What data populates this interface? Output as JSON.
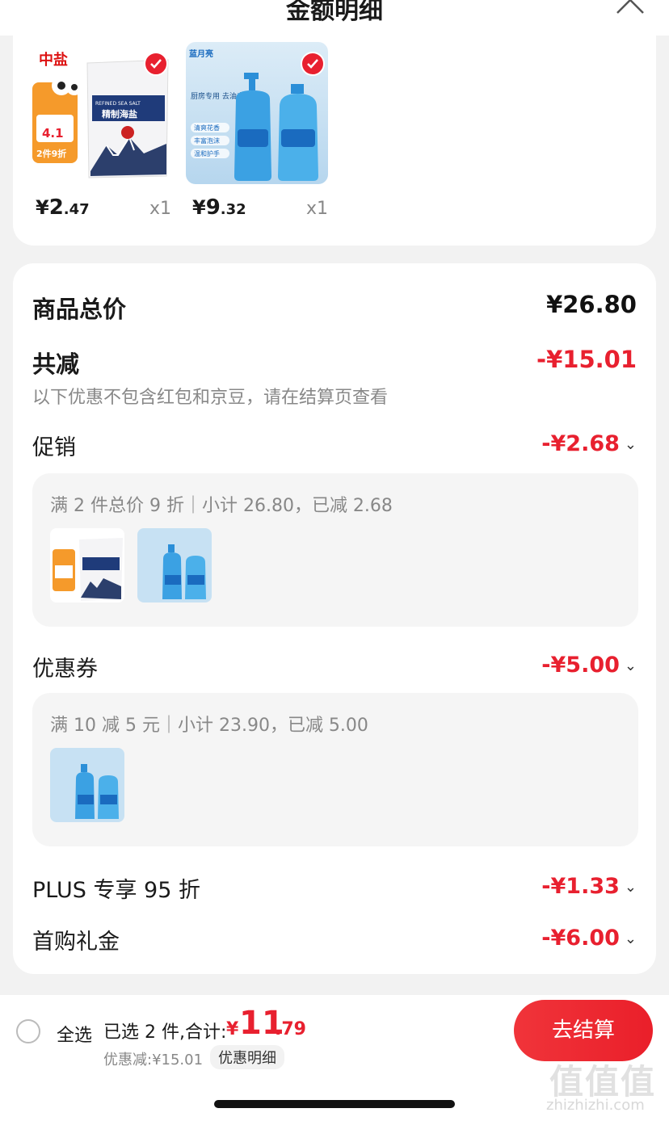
{
  "header": {
    "title": "金额明细"
  },
  "products": [
    {
      "name": "salt",
      "price_int": "2",
      "price_dec": ".47",
      "currency": "¥",
      "qty": "x1",
      "selected": true
    },
    {
      "name": "handwash",
      "price_int": "9",
      "price_dec": ".32",
      "currency": "¥",
      "qty": "x1",
      "selected": true
    }
  ],
  "product_image_text": {
    "salt_brand": "中盐",
    "salt_pkg_en": "REFINED SEA SALT",
    "salt_pkg_cn": "精制海盐",
    "salt_promo_price": "4.1",
    "salt_promo_deal": "2件9折",
    "wash_brand": "蓝月亮",
    "wash_caption": "厨房专用 去油去油腻",
    "wash_tags": [
      "清爽花香",
      "丰富泡沫",
      "温和护手"
    ]
  },
  "summary": {
    "total_label": "商品总价",
    "total_value": "¥26.80",
    "reduce_label": "共减",
    "reduce_value": "-¥15.01",
    "note": "以下优惠不包含红包和京豆，请在结算页查看"
  },
  "promotion": {
    "label": "促销",
    "value": "-¥2.68",
    "detail": "满 2 件总价 9 折｜小计 26.80，已减 2.68"
  },
  "coupon": {
    "label": "优惠券",
    "value": "-¥5.00",
    "detail": "满 10 减 5 元｜小计 23.90，已减 5.00"
  },
  "plus": {
    "label": "PLUS 专享 95 折",
    "value": "-¥1.33"
  },
  "first_buy": {
    "label": "首购礼金",
    "value": "-¥6.00"
  },
  "bottom": {
    "select_all": "全选",
    "selected_text": "已选 2 件,合计:",
    "total_currency": "¥",
    "total_int": "11",
    "total_dec": ".79",
    "discount_text": "优惠减:¥15.01",
    "detail_badge": "优惠明细",
    "checkout": "去结算"
  },
  "watermark": {
    "logo": "值值值",
    "url": "zhizhizhi.com"
  },
  "colors": {
    "accent": "#e8202f",
    "background": "#f2f2f2",
    "card": "#ffffff"
  }
}
